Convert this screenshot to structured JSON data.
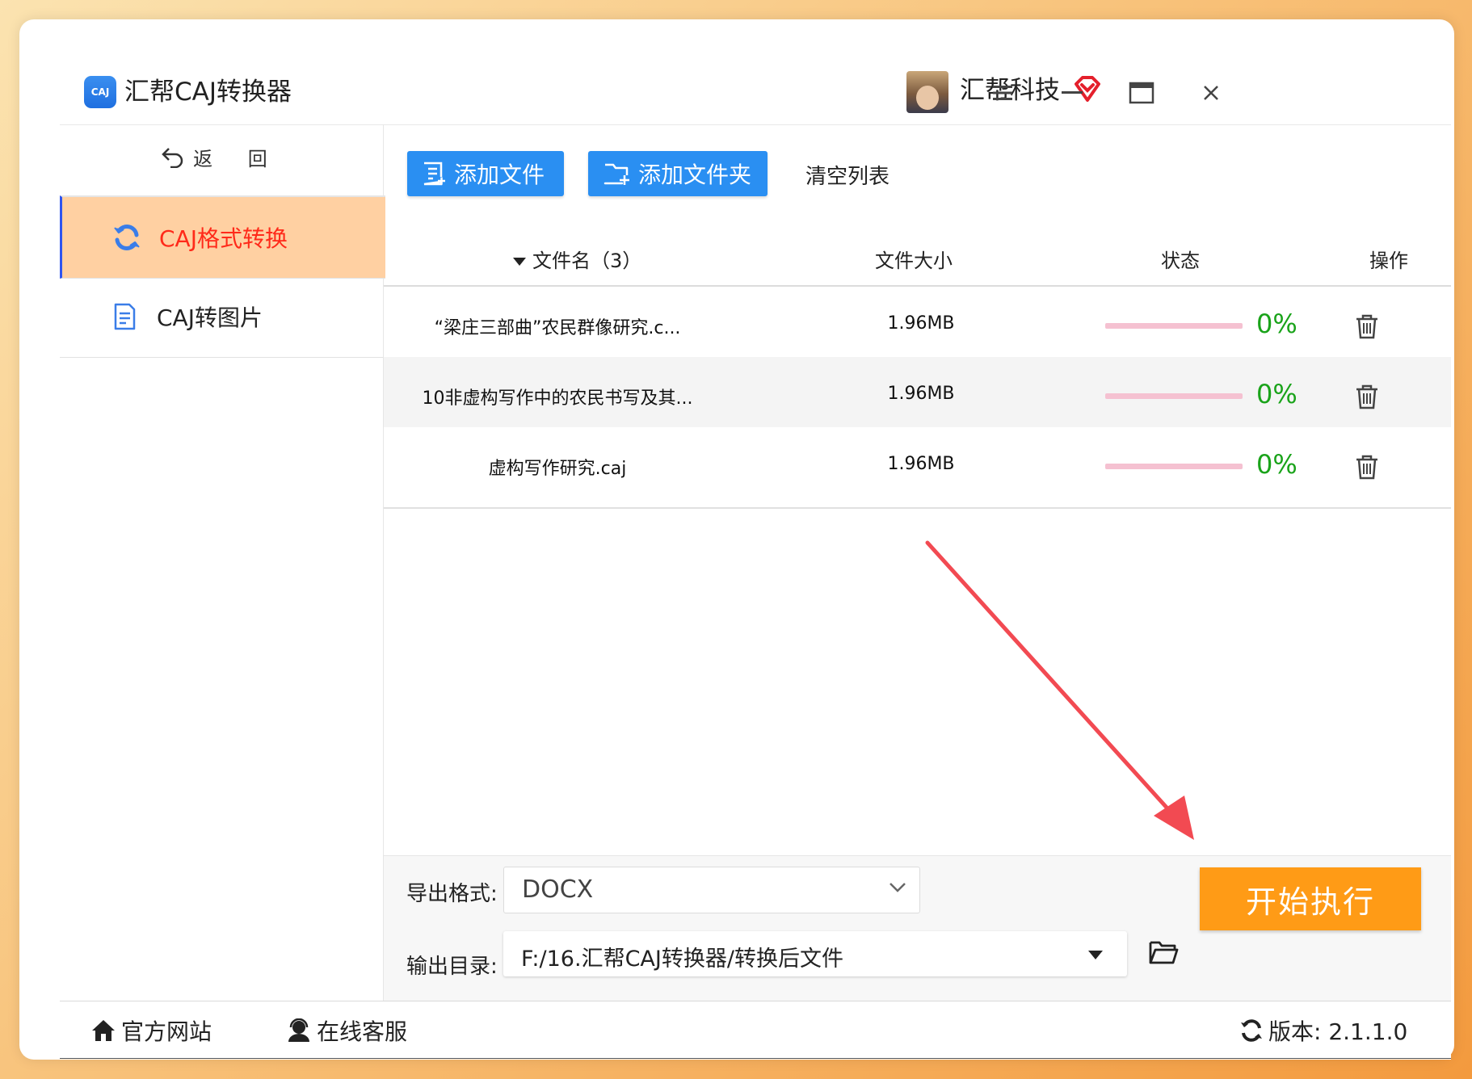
{
  "app": {
    "title": "汇帮CAJ转换器",
    "company": "汇帮科技"
  },
  "sidebar": {
    "back_label": "返 回",
    "items": [
      {
        "label": "CAJ格式转换",
        "active": true
      },
      {
        "label": "CAJ转图片",
        "active": false
      }
    ]
  },
  "toolbar": {
    "add_file": "添加文件",
    "add_folder": "添加文件夹",
    "clear_list": "清空列表"
  },
  "table": {
    "headers": {
      "name": "文件名（3）",
      "size": "文件大小",
      "status": "状态",
      "operation": "操作"
    },
    "rows": [
      {
        "name": "“梁庄三部曲”农民群像研究.c...",
        "size": "1.96MB",
        "progress": "0%"
      },
      {
        "name": "10非虚构写作中的农民书写及其...",
        "size": "1.96MB",
        "progress": "0%"
      },
      {
        "name": "虚构写作研究.caj",
        "size": "1.96MB",
        "progress": "0%"
      }
    ]
  },
  "bottom": {
    "format_label": "导出格式:",
    "format_value": "DOCX",
    "output_label": "输出目录:",
    "output_value": "F:/16.汇帮CAJ转换器/转换后文件",
    "start_button": "开始执行"
  },
  "footer": {
    "site": "官方网站",
    "service": "在线客服",
    "version": "版本: 2.1.1.0"
  },
  "colors": {
    "accent_blue": "#2a8ff2",
    "active_nav_bg": "#ffd0a2",
    "active_nav_text": "#ff2a1a",
    "start_orange": "#ff9b16",
    "progress_green": "#1aa31a",
    "annotation_arrow": "#f24a52"
  },
  "icons": [
    "caj-logo-icon",
    "vip-diamond-icon",
    "menu-icon",
    "minimize-icon",
    "maximize-icon",
    "close-icon",
    "back-arrow-icon",
    "refresh-convert-icon",
    "document-icon",
    "add-file-icon",
    "add-folder-icon",
    "sort-down-icon",
    "trash-icon",
    "chevron-down-icon",
    "folder-open-icon",
    "home-icon",
    "customer-service-icon",
    "refresh-icon"
  ]
}
